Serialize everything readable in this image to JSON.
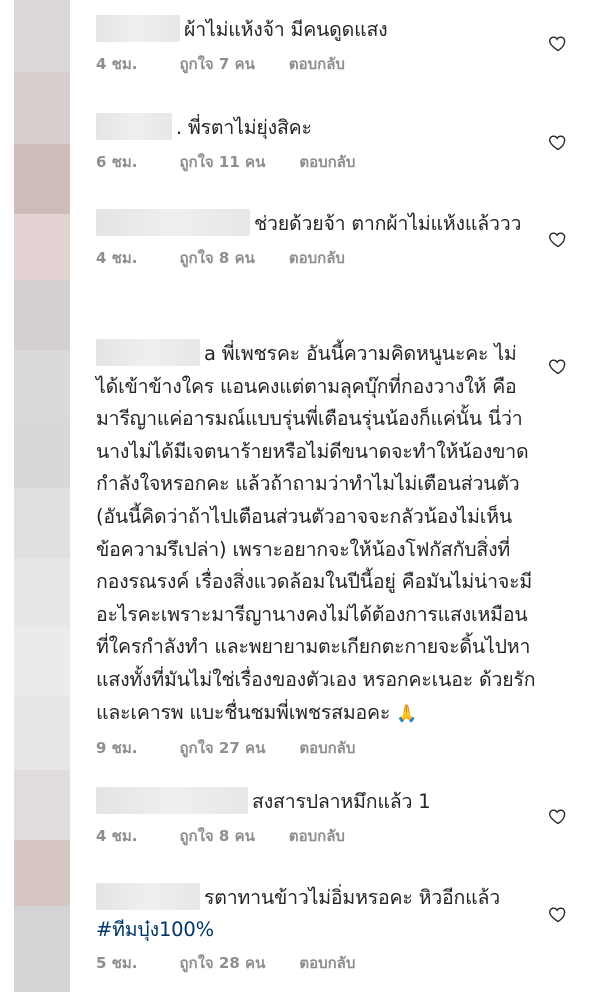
{
  "comments": [
    {
      "text": "ผ้าไม่แห้งจ้า มีคนดูดแสง",
      "time": "4 ชม.",
      "likes": "ถูกใจ 7 คน",
      "reply": "ตอบกลับ"
    },
    {
      "text": ". พี่รตาไม่ยุ่งสิคะ",
      "time": "6 ชม.",
      "likes": "ถูกใจ 11 คน",
      "reply": "ตอบกลับ"
    },
    {
      "text": "ช่วยด้วยจ้า ตากผ้าไม่แห้งแล้ววว",
      "time": "4 ชม.",
      "likes": "ถูกใจ 8 คน",
      "reply": "ตอบกลับ"
    },
    {
      "text": "a พี่เพชรคะ  อันนี้ความคิดหนูนะคะ ไม่ได้เข้าข้างใคร แอนคงแต่ตามลุคบุ๊กที่กองวางให้ คือมารีญาแค่อารมณ์แบบรุ่นพี่เตือนรุ่นน้องก็แค่นั้น นี่ว่านางไม่ได้มีเจตนาร้ายหรือไม่ดีขนาดจะทำให้น้องขาดกำลังใจหรอกคะ แล้วถ้าถามว่าทำไมไม่เตือนส่วนตัว (อันนี้คิดว่าถ้าไปเตือนส่วนตัวอาจจะกลัวน้องไม่เห็นข้อความรึเปล่า) เพราะอยากจะให้น้องโฟกัสกับสิ่งที่กองรณรงค์ เรื่องสิ่งแวดล้อมในปีนี้อยู่ คือมันไม่น่าจะมีอะไรคะเพราะมารีญานางคงไม่ได้ต้องการแสงเหมือนที่ใครกำลังทำ และพยายามตะเกียกตะกายจะดิ้นไปหาแสงทั้งที่มันไม่ใช่เรื่องของตัวเอง หรอกคะเนอะ ด้วยรักและเคารพ แบะชื่นชมพี่เพชรสมอคะ",
      "emoji": "🙏",
      "time": "9 ชม.",
      "likes": "ถูกใจ 27 คน",
      "reply": "ตอบกลับ"
    },
    {
      "text": "สงสารปลาหมึกแล้ว 1",
      "time": "4 ชม.",
      "likes": "ถูกใจ 8 คน",
      "reply": "ตอบกลับ"
    },
    {
      "text": "รตาทานข้าวไม่อิ่มหรอคะ หิวอีกแล้ว",
      "hashtag": "#ทีมบุ๋ง100%",
      "time": "5 ชม.",
      "likes": "ถูกใจ 28 คน",
      "reply": "ตอบกลับ"
    }
  ],
  "icons": {
    "like": "heart-outline-icon"
  },
  "colors": {
    "meta": "#8e8e8e",
    "text": "#262626",
    "hashtag": "#003569"
  }
}
